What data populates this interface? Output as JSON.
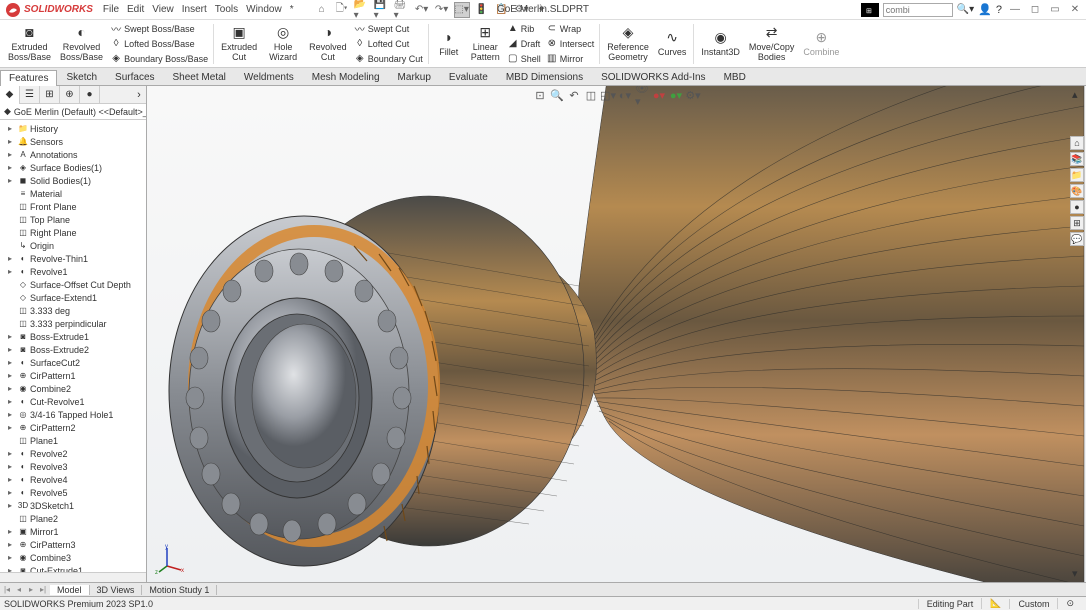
{
  "app": {
    "brand": "SOLIDWORKS",
    "title": "GoE Merlin.SLDPRT"
  },
  "menu": {
    "file": "File",
    "edit": "Edit",
    "view": "View",
    "insert": "Insert",
    "tools": "Tools",
    "window": "Window",
    "help": "*"
  },
  "search": {
    "placeholder": "combi"
  },
  "ribbon": {
    "extruded_boss": "Extruded\nBoss/Base",
    "revolved_boss": "Revolved\nBoss/Base",
    "swept_boss": "Swept Boss/Base",
    "lofted_boss": "Lofted Boss/Base",
    "boundary_boss": "Boundary Boss/Base",
    "extruded_cut": "Extruded\nCut",
    "hole_wizard": "Hole\nWizard",
    "revolved_cut": "Revolved\nCut",
    "swept_cut": "Swept Cut",
    "lofted_cut": "Lofted Cut",
    "boundary_cut": "Boundary Cut",
    "fillet": "Fillet",
    "linear_pattern": "Linear\nPattern",
    "rib": "Rib",
    "draft": "Draft",
    "shell": "Shell",
    "wrap": "Wrap",
    "intersect": "Intersect",
    "mirror": "Mirror",
    "ref_geom": "Reference\nGeometry",
    "curves": "Curves",
    "instant3d": "Instant3D",
    "move_copy": "Move/Copy\nBodies",
    "combine": "Combine"
  },
  "tabs": [
    "Features",
    "Sketch",
    "Surfaces",
    "Sheet Metal",
    "Weldments",
    "Mesh Modeling",
    "Markup",
    "Evaluate",
    "MBD Dimensions",
    "SOLIDWORKS Add-Ins",
    "MBD"
  ],
  "tree": {
    "root": "GoE Merlin (Default) <<Default>_Display S",
    "items": [
      {
        "icon": "📁",
        "label": "History",
        "toggle": "▸"
      },
      {
        "icon": "🔔",
        "label": "Sensors",
        "toggle": "▸"
      },
      {
        "icon": "A",
        "label": "Annotations",
        "toggle": "▸"
      },
      {
        "icon": "◈",
        "label": "Surface Bodies(1)",
        "toggle": "▸"
      },
      {
        "icon": "◼",
        "label": "Solid Bodies(1)",
        "toggle": "▸"
      },
      {
        "icon": "≡",
        "label": "Material <not specified>",
        "toggle": ""
      },
      {
        "icon": "◫",
        "label": "Front Plane",
        "toggle": ""
      },
      {
        "icon": "◫",
        "label": "Top Plane",
        "toggle": ""
      },
      {
        "icon": "◫",
        "label": "Right Plane",
        "toggle": ""
      },
      {
        "icon": "↳",
        "label": "Origin",
        "toggle": ""
      },
      {
        "icon": "◐",
        "label": "Revolve-Thin1",
        "toggle": "▸"
      },
      {
        "icon": "◐",
        "label": "Revolve1",
        "toggle": "▸"
      },
      {
        "icon": "◇",
        "label": "Surface-Offset Cut Depth",
        "toggle": ""
      },
      {
        "icon": "◇",
        "label": "Surface-Extend1",
        "toggle": ""
      },
      {
        "icon": "◫",
        "label": "3.333 deg",
        "toggle": ""
      },
      {
        "icon": "◫",
        "label": "3.333 perpindicular",
        "toggle": ""
      },
      {
        "icon": "◙",
        "label": "Boss-Extrude1",
        "toggle": "▸"
      },
      {
        "icon": "◙",
        "label": "Boss-Extrude2",
        "toggle": "▸"
      },
      {
        "icon": "◐",
        "label": "SurfaceCut2",
        "toggle": "▸"
      },
      {
        "icon": "⊕",
        "label": "CirPattern1",
        "toggle": "▸"
      },
      {
        "icon": "◉",
        "label": "Combine2",
        "toggle": "▸"
      },
      {
        "icon": "◐",
        "label": "Cut-Revolve1",
        "toggle": "▸"
      },
      {
        "icon": "◎",
        "label": "3/4-16 Tapped Hole1",
        "toggle": "▸"
      },
      {
        "icon": "⊕",
        "label": "CirPattern2",
        "toggle": "▸"
      },
      {
        "icon": "◫",
        "label": "Plane1",
        "toggle": ""
      },
      {
        "icon": "◐",
        "label": "Revolve2",
        "toggle": "▸"
      },
      {
        "icon": "◐",
        "label": "Revolve3",
        "toggle": "▸"
      },
      {
        "icon": "◐",
        "label": "Revolve4",
        "toggle": "▸"
      },
      {
        "icon": "◐",
        "label": "Revolve5",
        "toggle": "▸"
      },
      {
        "icon": "3D",
        "label": "3DSketch1",
        "toggle": "▸"
      },
      {
        "icon": "◫",
        "label": "Plane2",
        "toggle": ""
      },
      {
        "icon": "▣",
        "label": "Mirror1",
        "toggle": "▸"
      },
      {
        "icon": "⊕",
        "label": "CirPattern3",
        "toggle": "▸"
      },
      {
        "icon": "◉",
        "label": "Combine3",
        "toggle": "▸"
      },
      {
        "icon": "◙",
        "label": "Cut-Extrude1",
        "toggle": "▸"
      }
    ]
  },
  "bottom_tabs": {
    "model": "Model",
    "views3d": "3D Views",
    "motion": "Motion Study 1"
  },
  "status": {
    "left": "SOLIDWORKS Premium 2023 SP1.0",
    "editing": "Editing Part",
    "custom": "Custom"
  }
}
